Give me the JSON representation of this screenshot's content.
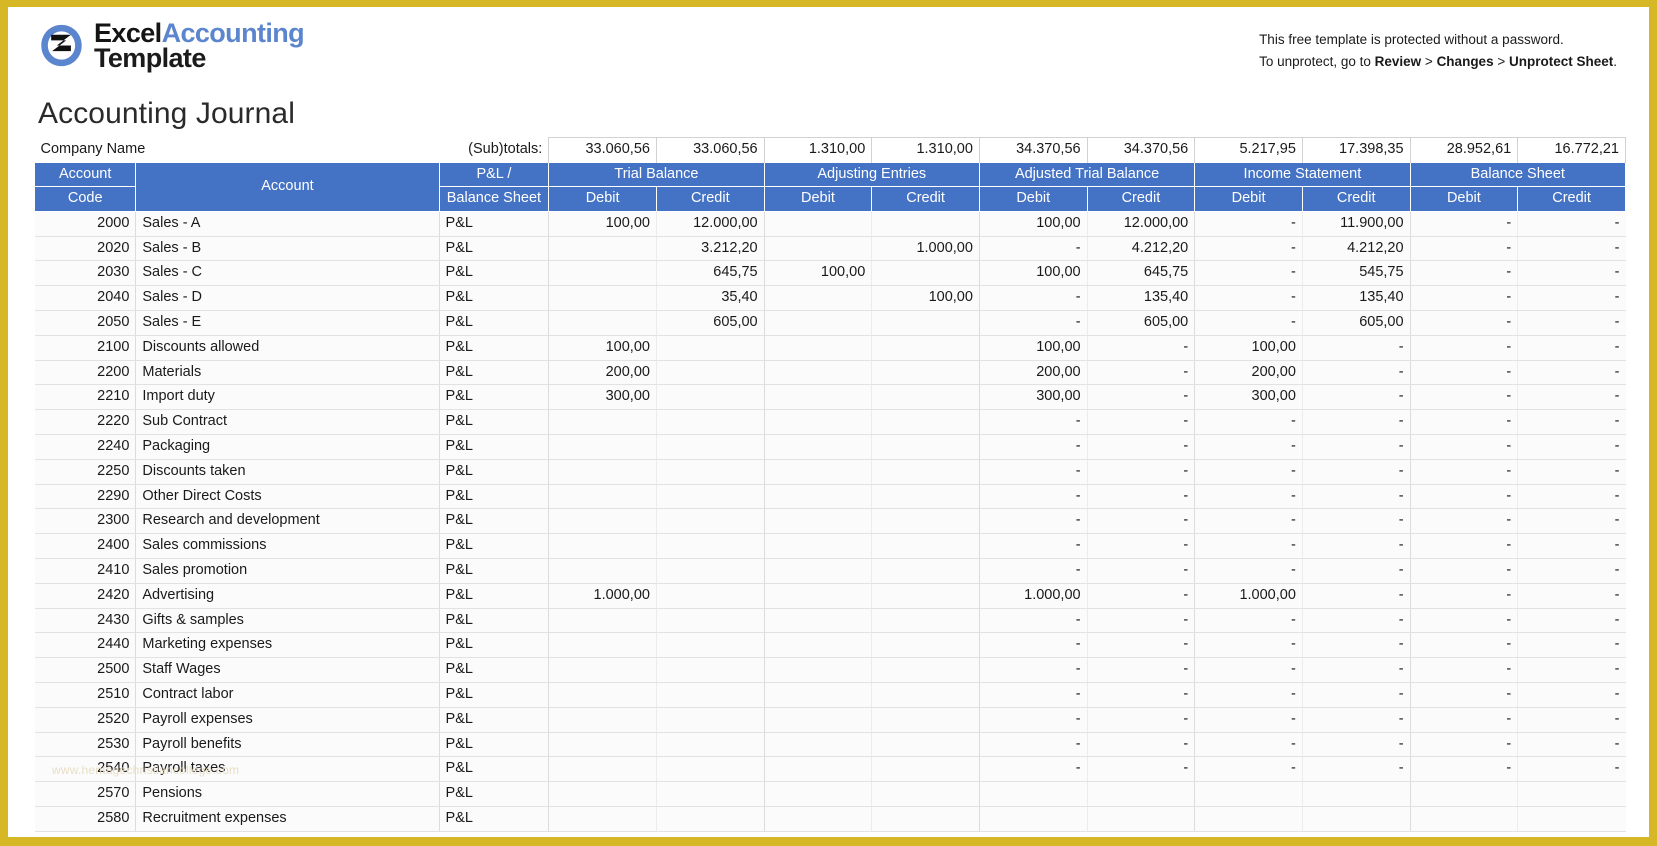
{
  "brand": {
    "logo_line1_dark": "Excel",
    "logo_line1_blue": "Accounting",
    "logo_line2": "Template",
    "accent_blue": "#5b86ce",
    "mark_blue": "#5b86ce",
    "mark_dark": "#111111"
  },
  "notice": {
    "line1": "This free template is protected without a password.",
    "line2_pre": "To unprotect, go to ",
    "line2_b1": "Review",
    "line2_sep1": " > ",
    "line2_b2": "Changes",
    "line2_sep2": " > ",
    "line2_b3": "Unprotect Sheet",
    "line2_end": "."
  },
  "page_title": "Accounting Journal",
  "company_name": "Company Name",
  "subtotals_label": "(Sub)totals:",
  "subtotals": [
    "33.060,56",
    "33.060,56",
    "1.310,00",
    "1.310,00",
    "34.370,56",
    "34.370,56",
    "5.217,95",
    "17.398,35",
    "28.952,61",
    "16.772,21"
  ],
  "headers": {
    "account_code_l1": "Account",
    "account_code_l2": "Code",
    "account": "Account",
    "pl_l1": "P&L /",
    "pl_l2": "Balance Sheet",
    "groups": [
      "Trial Balance",
      "Adjusting Entries",
      "Adjusted Trial Balance",
      "Income Statement",
      "Balance Sheet"
    ],
    "debit": "Debit",
    "credit": "Credit"
  },
  "colors": {
    "header_blue": "#4472c4",
    "frame_gold": "#d6b827",
    "row_bg": "#fbfbfb",
    "grid_line": "#e2e2e2"
  },
  "watermark": "www.heritagechristiancollege.com",
  "rows": [
    {
      "code": "2000",
      "name": "Sales - A",
      "pl": "P&L",
      "v": [
        "100,00",
        "12.000,00",
        "",
        "",
        "100,00",
        "12.000,00",
        "-",
        "11.900,00",
        "-",
        "-"
      ]
    },
    {
      "code": "2020",
      "name": "Sales - B",
      "pl": "P&L",
      "v": [
        "",
        "3.212,20",
        "",
        "1.000,00",
        "-",
        "4.212,20",
        "-",
        "4.212,20",
        "-",
        "-"
      ]
    },
    {
      "code": "2030",
      "name": "Sales - C",
      "pl": "P&L",
      "v": [
        "",
        "645,75",
        "100,00",
        "",
        "100,00",
        "645,75",
        "-",
        "545,75",
        "-",
        "-"
      ]
    },
    {
      "code": "2040",
      "name": "Sales - D",
      "pl": "P&L",
      "v": [
        "",
        "35,40",
        "",
        "100,00",
        "-",
        "135,40",
        "-",
        "135,40",
        "-",
        "-"
      ]
    },
    {
      "code": "2050",
      "name": "Sales - E",
      "pl": "P&L",
      "v": [
        "",
        "605,00",
        "",
        "",
        "-",
        "605,00",
        "-",
        "605,00",
        "-",
        "-"
      ]
    },
    {
      "code": "2100",
      "name": "Discounts allowed",
      "pl": "P&L",
      "v": [
        "100,00",
        "",
        "",
        "",
        "100,00",
        "-",
        "100,00",
        "-",
        "-",
        "-"
      ]
    },
    {
      "code": "2200",
      "name": "Materials",
      "pl": "P&L",
      "v": [
        "200,00",
        "",
        "",
        "",
        "200,00",
        "-",
        "200,00",
        "-",
        "-",
        "-"
      ]
    },
    {
      "code": "2210",
      "name": "Import duty",
      "pl": "P&L",
      "v": [
        "300,00",
        "",
        "",
        "",
        "300,00",
        "-",
        "300,00",
        "-",
        "-",
        "-"
      ]
    },
    {
      "code": "2220",
      "name": "Sub Contract",
      "pl": "P&L",
      "v": [
        "",
        "",
        "",
        "",
        "-",
        "-",
        "-",
        "-",
        "-",
        "-"
      ]
    },
    {
      "code": "2240",
      "name": "Packaging",
      "pl": "P&L",
      "v": [
        "",
        "",
        "",
        "",
        "-",
        "-",
        "-",
        "-",
        "-",
        "-"
      ]
    },
    {
      "code": "2250",
      "name": "Discounts taken",
      "pl": "P&L",
      "v": [
        "",
        "",
        "",
        "",
        "-",
        "-",
        "-",
        "-",
        "-",
        "-"
      ]
    },
    {
      "code": "2290",
      "name": "Other Direct Costs",
      "pl": "P&L",
      "v": [
        "",
        "",
        "",
        "",
        "-",
        "-",
        "-",
        "-",
        "-",
        "-"
      ]
    },
    {
      "code": "2300",
      "name": "Research and development",
      "pl": "P&L",
      "v": [
        "",
        "",
        "",
        "",
        "-",
        "-",
        "-",
        "-",
        "-",
        "-"
      ]
    },
    {
      "code": "2400",
      "name": "Sales commissions",
      "pl": "P&L",
      "v": [
        "",
        "",
        "",
        "",
        "-",
        "-",
        "-",
        "-",
        "-",
        "-"
      ]
    },
    {
      "code": "2410",
      "name": "Sales promotion",
      "pl": "P&L",
      "v": [
        "",
        "",
        "",
        "",
        "-",
        "-",
        "-",
        "-",
        "-",
        "-"
      ]
    },
    {
      "code": "2420",
      "name": "Advertising",
      "pl": "P&L",
      "v": [
        "1.000,00",
        "",
        "",
        "",
        "1.000,00",
        "-",
        "1.000,00",
        "-",
        "-",
        "-"
      ]
    },
    {
      "code": "2430",
      "name": "Gifts & samples",
      "pl": "P&L",
      "v": [
        "",
        "",
        "",
        "",
        "-",
        "-",
        "-",
        "-",
        "-",
        "-"
      ]
    },
    {
      "code": "2440",
      "name": "Marketing expenses",
      "pl": "P&L",
      "v": [
        "",
        "",
        "",
        "",
        "-",
        "-",
        "-",
        "-",
        "-",
        "-"
      ]
    },
    {
      "code": "2500",
      "name": "Staff Wages",
      "pl": "P&L",
      "v": [
        "",
        "",
        "",
        "",
        "-",
        "-",
        "-",
        "-",
        "-",
        "-"
      ]
    },
    {
      "code": "2510",
      "name": "Contract labor",
      "pl": "P&L",
      "v": [
        "",
        "",
        "",
        "",
        "-",
        "-",
        "-",
        "-",
        "-",
        "-"
      ]
    },
    {
      "code": "2520",
      "name": "Payroll expenses",
      "pl": "P&L",
      "v": [
        "",
        "",
        "",
        "",
        "-",
        "-",
        "-",
        "-",
        "-",
        "-"
      ]
    },
    {
      "code": "2530",
      "name": "Payroll benefits",
      "pl": "P&L",
      "v": [
        "",
        "",
        "",
        "",
        "-",
        "-",
        "-",
        "-",
        "-",
        "-"
      ]
    },
    {
      "code": "2540",
      "name": "Payroll taxes",
      "pl": "P&L",
      "v": [
        "",
        "",
        "",
        "",
        "-",
        "-",
        "-",
        "-",
        "-",
        "-"
      ]
    },
    {
      "code": "2570",
      "name": "Pensions",
      "pl": "P&L",
      "v": [
        "",
        "",
        "",
        "",
        "",
        "",
        "",
        "",
        "",
        ""
      ]
    },
    {
      "code": "2580",
      "name": "Recruitment expenses",
      "pl": "P&L",
      "v": [
        "",
        "",
        "",
        "",
        "",
        "",
        "",
        "",
        "",
        ""
      ]
    }
  ]
}
